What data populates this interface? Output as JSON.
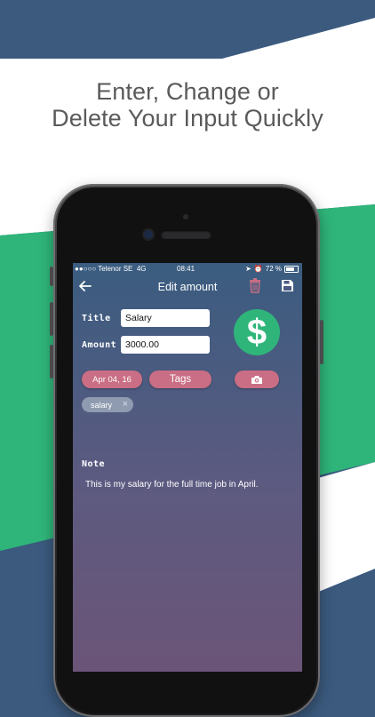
{
  "banner": {
    "line1": "Enter, Change or",
    "line2": "Delete Your Input Quickly"
  },
  "colors": {
    "background_blue": "#3b5a7e",
    "accent_green": "#2fb57a",
    "pill_pink": "#c96e84"
  },
  "status_bar": {
    "carrier": "●●○○○ Telenor SE",
    "network": "4G",
    "time": "08:41",
    "battery": "72 %"
  },
  "nav": {
    "title": "Edit amount",
    "back_icon": "arrow-left-icon",
    "delete_icon": "trash-icon",
    "save_icon": "save-icon"
  },
  "form": {
    "title_label": "Title",
    "title_value": "Salary",
    "amount_label": "Amount",
    "amount_value": "3000.00",
    "currency_symbol": "$",
    "date_button": "Apr 04, 16",
    "tags_button": "Tags",
    "camera_icon": "camera-icon",
    "tag_chip": "salary",
    "tag_remove": "×",
    "note_label": "Note",
    "note_text": "This is my salary for the full time job in April."
  }
}
